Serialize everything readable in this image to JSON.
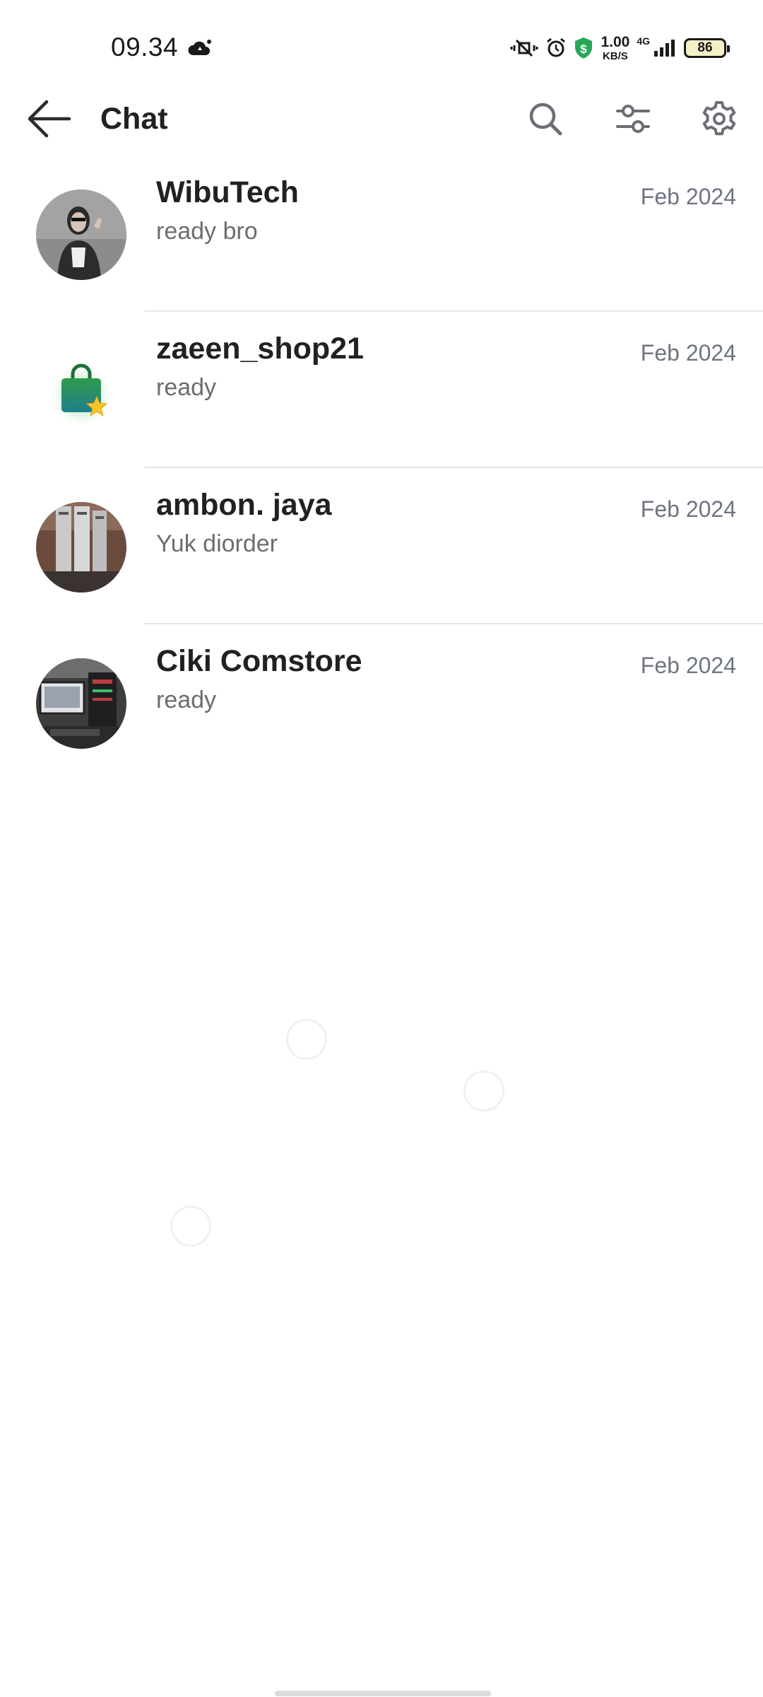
{
  "status_bar": {
    "time": "09.34",
    "net_speed_value": "1.00",
    "net_speed_unit": "KB/S",
    "network_type": "4G",
    "battery_level": "86"
  },
  "app_bar": {
    "title": "Chat"
  },
  "chats": [
    {
      "name": "WibuTech",
      "preview": "ready bro",
      "date": "Feb 2024",
      "avatar_icon": "person-photo"
    },
    {
      "name": "zaeen_shop21",
      "preview": "ready",
      "date": "Feb 2024",
      "avatar_icon": "shopping-bag-star-icon"
    },
    {
      "name": "ambon. jaya",
      "preview": "Yuk diorder",
      "date": "Feb 2024",
      "avatar_icon": "store-photo"
    },
    {
      "name": "Ciki Comstore",
      "preview": "ready",
      "date": "Feb 2024",
      "avatar_icon": "computer-setup-photo"
    }
  ],
  "colors": {
    "accent_green": "#2aa65a",
    "title_text": "#212121",
    "secondary_text": "#6d6d6d",
    "date_text": "#6e7480",
    "divider": "#e6e6e6"
  }
}
